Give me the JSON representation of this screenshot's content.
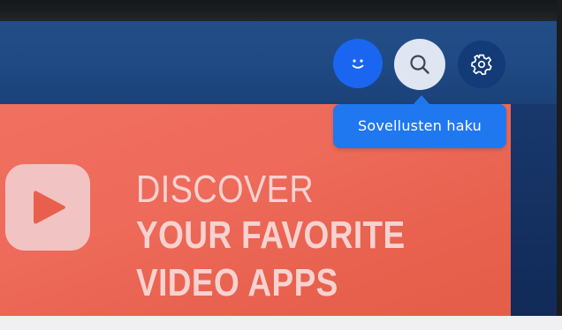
{
  "banner": {
    "line1": "DISCOVER",
    "line2": "YOUR FAVORITE",
    "line3": "VIDEO APPS"
  },
  "toolbar": {
    "buttons": [
      {
        "name": "profile",
        "icon": "smiley-icon"
      },
      {
        "name": "search",
        "icon": "search-icon"
      },
      {
        "name": "settings",
        "icon": "gear-icon"
      }
    ],
    "tooltip": "Sovellusten haku"
  },
  "colors": {
    "header_blue": "#1f4a84",
    "banner_coral": "#ee6a5a",
    "profile_blue": "#1a66f0",
    "tooltip_blue": "#1f78f0",
    "search_highlight": "#dfe6f2",
    "headline_pink": "#f7d2d0"
  }
}
